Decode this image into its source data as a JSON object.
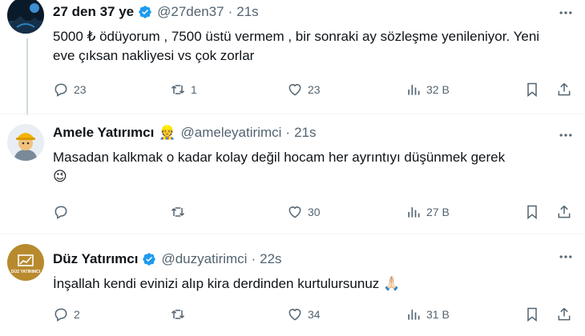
{
  "tweets": [
    {
      "name": "27 den 37 ye",
      "verified": true,
      "handle": "@27den37",
      "dot": "·",
      "time": "21s",
      "text": "5000 ₺ ödüyorum , 7500 üstü vermem , bir sonraki ay sözleşme yenileniyor. Yeni eve çıksan nakliyesi vs çok zorlar",
      "replies": "23",
      "retweets": "1",
      "likes": "23",
      "views": "32 B"
    },
    {
      "name": "Amele Yatırımcı",
      "verified": false,
      "name_emoji": "👷",
      "handle": "@ameleyatirimci",
      "dot": "·",
      "time": "21s",
      "text": "Masadan kalkmak o kadar kolay değil hocam her ayrıntıyı düşünmek gerek",
      "trailing_emoji": "😉",
      "replies": "",
      "retweets": "",
      "likes": "30",
      "views": "27 B"
    },
    {
      "name": "Düz Yatırımcı",
      "verified": true,
      "handle": "@duzyatirimci",
      "dot": "·",
      "time": "22s",
      "text": "İnşallah kendi evinizi alıp kira derdinden kurtulursunuz",
      "trailing_emoji": "🙏🏻",
      "avatar_logo_text": "DÜZ YATIRIMCI",
      "replies": "2",
      "retweets": "",
      "likes": "34",
      "views": "31 B"
    }
  ],
  "icons": {
    "reply": "reply-icon",
    "retweet": "retweet-icon",
    "like": "heart-icon",
    "views": "views-chart-icon",
    "bookmark": "bookmark-icon",
    "share": "share-icon",
    "more": "more-dots-icon",
    "verified": "verified-badge-icon"
  },
  "colors": {
    "verified": "#1d9bf0",
    "muted": "#536471",
    "avatar3": "#b88a2e"
  }
}
